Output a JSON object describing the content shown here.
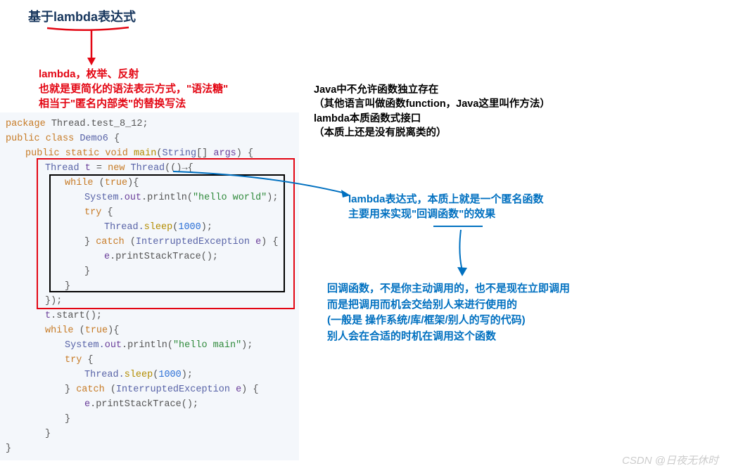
{
  "title": {
    "prefix": "基于",
    "keyword": "lambda",
    "suffix": "表达式"
  },
  "red_note": {
    "l1": "lambda，枚举、反射",
    "l2": "也就是更简化的语法表示方式，\"语法糖\"",
    "l3": "相当于\"匿名内部类\"的替换写法"
  },
  "black_note": {
    "l1": "Java中不允许函数独立存在",
    "l2": "（其他语言叫做函数function，Java这里叫作方法）",
    "l3": "lambda本质函数式接口",
    "l4": "（本质上还是没有脱离类的）"
  },
  "blue_note_1": {
    "l1": "lambda表达式，本质上就是一个匿名函数",
    "l2": "主要用来实现\"回调函数\"的效果"
  },
  "blue_note_2": {
    "l1": "回调函数，不是你主动调用的，也不是现在立即调用",
    "l2": "而是把调用而机会交给别人来进行使用的",
    "l3": "(一般是 操作系统/库/框架/别人的写的代码)",
    "l4": "别人会在合适的时机在调用这个函数"
  },
  "code": {
    "l1": {
      "a": "package ",
      "b": "Thread.test_8_12",
      ";": ""
    },
    "l2": {
      "a": "public class ",
      "b": "Demo6",
      " {": ""
    },
    "l3": {
      "a": "public static void ",
      "b": "main",
      "c": "(",
      "d": "String",
      "e": "[] ",
      "f": "args",
      "g": ") {"
    },
    "l4": {
      "a": "Thread ",
      "b": "t",
      " = ": "",
      "c": "new ",
      "d": "Thread",
      "e": "(()",
      "arrow": "→",
      "f": "{"
    },
    "l5": {
      "a": "while ",
      "b": "(",
      "c": "true",
      "d": "){"
    },
    "l6": {
      "a": "System.",
      "b": "out",
      "c": ".println(",
      "d": "\"hello world\"",
      "e": ");"
    },
    "l7": {
      "a": "try ",
      "b": "{"
    },
    "l8": {
      "a": "Thread.",
      "b": "sleep",
      "c": "(",
      "d": "1000",
      "e": ");"
    },
    "l9": {
      "a": "} ",
      "b": "catch ",
      "c": "(",
      "d": "InterruptedException ",
      "e": "e",
      "f": ") {"
    },
    "l10": {
      "a": "e",
      "b": ".printStackTrace();"
    },
    "l11": "}",
    "l12": "}",
    "l13": "});",
    "l14": {
      "a": "t",
      "b": ".start();"
    },
    "l15": {
      "a": "while ",
      "b": "(",
      "c": "true",
      "d": "){"
    },
    "l16": {
      "a": "System.",
      "b": "out",
      "c": ".println(",
      "d": "\"hello main\"",
      "e": ");"
    },
    "l17": {
      "a": "try ",
      "b": "{"
    },
    "l18": {
      "a": "Thread.",
      "b": "sleep",
      "c": "(",
      "d": "1000",
      "e": ");"
    },
    "l19": {
      "a": "} ",
      "b": "catch ",
      "c": "(",
      "d": "InterruptedException ",
      "e": "e",
      "f": ") {"
    },
    "l20": {
      "a": "e",
      "b": ".printStackTrace();"
    },
    "l21": "}",
    "l22": "}",
    "l23": "}"
  },
  "watermark": "CSDN @日夜无休时"
}
